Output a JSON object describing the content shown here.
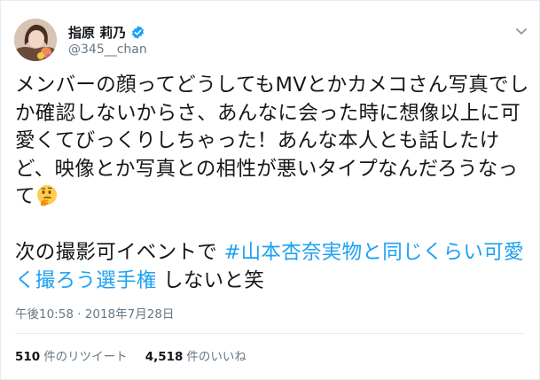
{
  "author": {
    "display_name": "指原 莉乃",
    "handle": "@345__chan",
    "verified": true
  },
  "tweet": {
    "text_main": "メンバーの顔ってどうしてもMVとかカメコさん写真でしか確認しないからさ、あんなに会った時に想像以上に可愛くてびっくりしちゃった！あんな本人とも話したけど、映像とか写真との相性が悪いタイプなんだろうなって",
    "emoji": "thinking-face",
    "text_line2_prefix": "次の撮影可イベントで ",
    "hashtag": "#山本杏奈実物と同じくらい可愛く撮ろう選手権",
    "text_line2_suffix": " しないと笑",
    "timestamp": "午後10:58 · 2018年7月28日"
  },
  "stats": {
    "retweets_count": "510",
    "retweets_label": "件のリツイート",
    "likes_count": "4,518",
    "likes_label": "件のいいね"
  },
  "colors": {
    "link": "#1da1f2",
    "text": "#14171a",
    "secondary": "#657786",
    "border": "#e6ecf0"
  }
}
